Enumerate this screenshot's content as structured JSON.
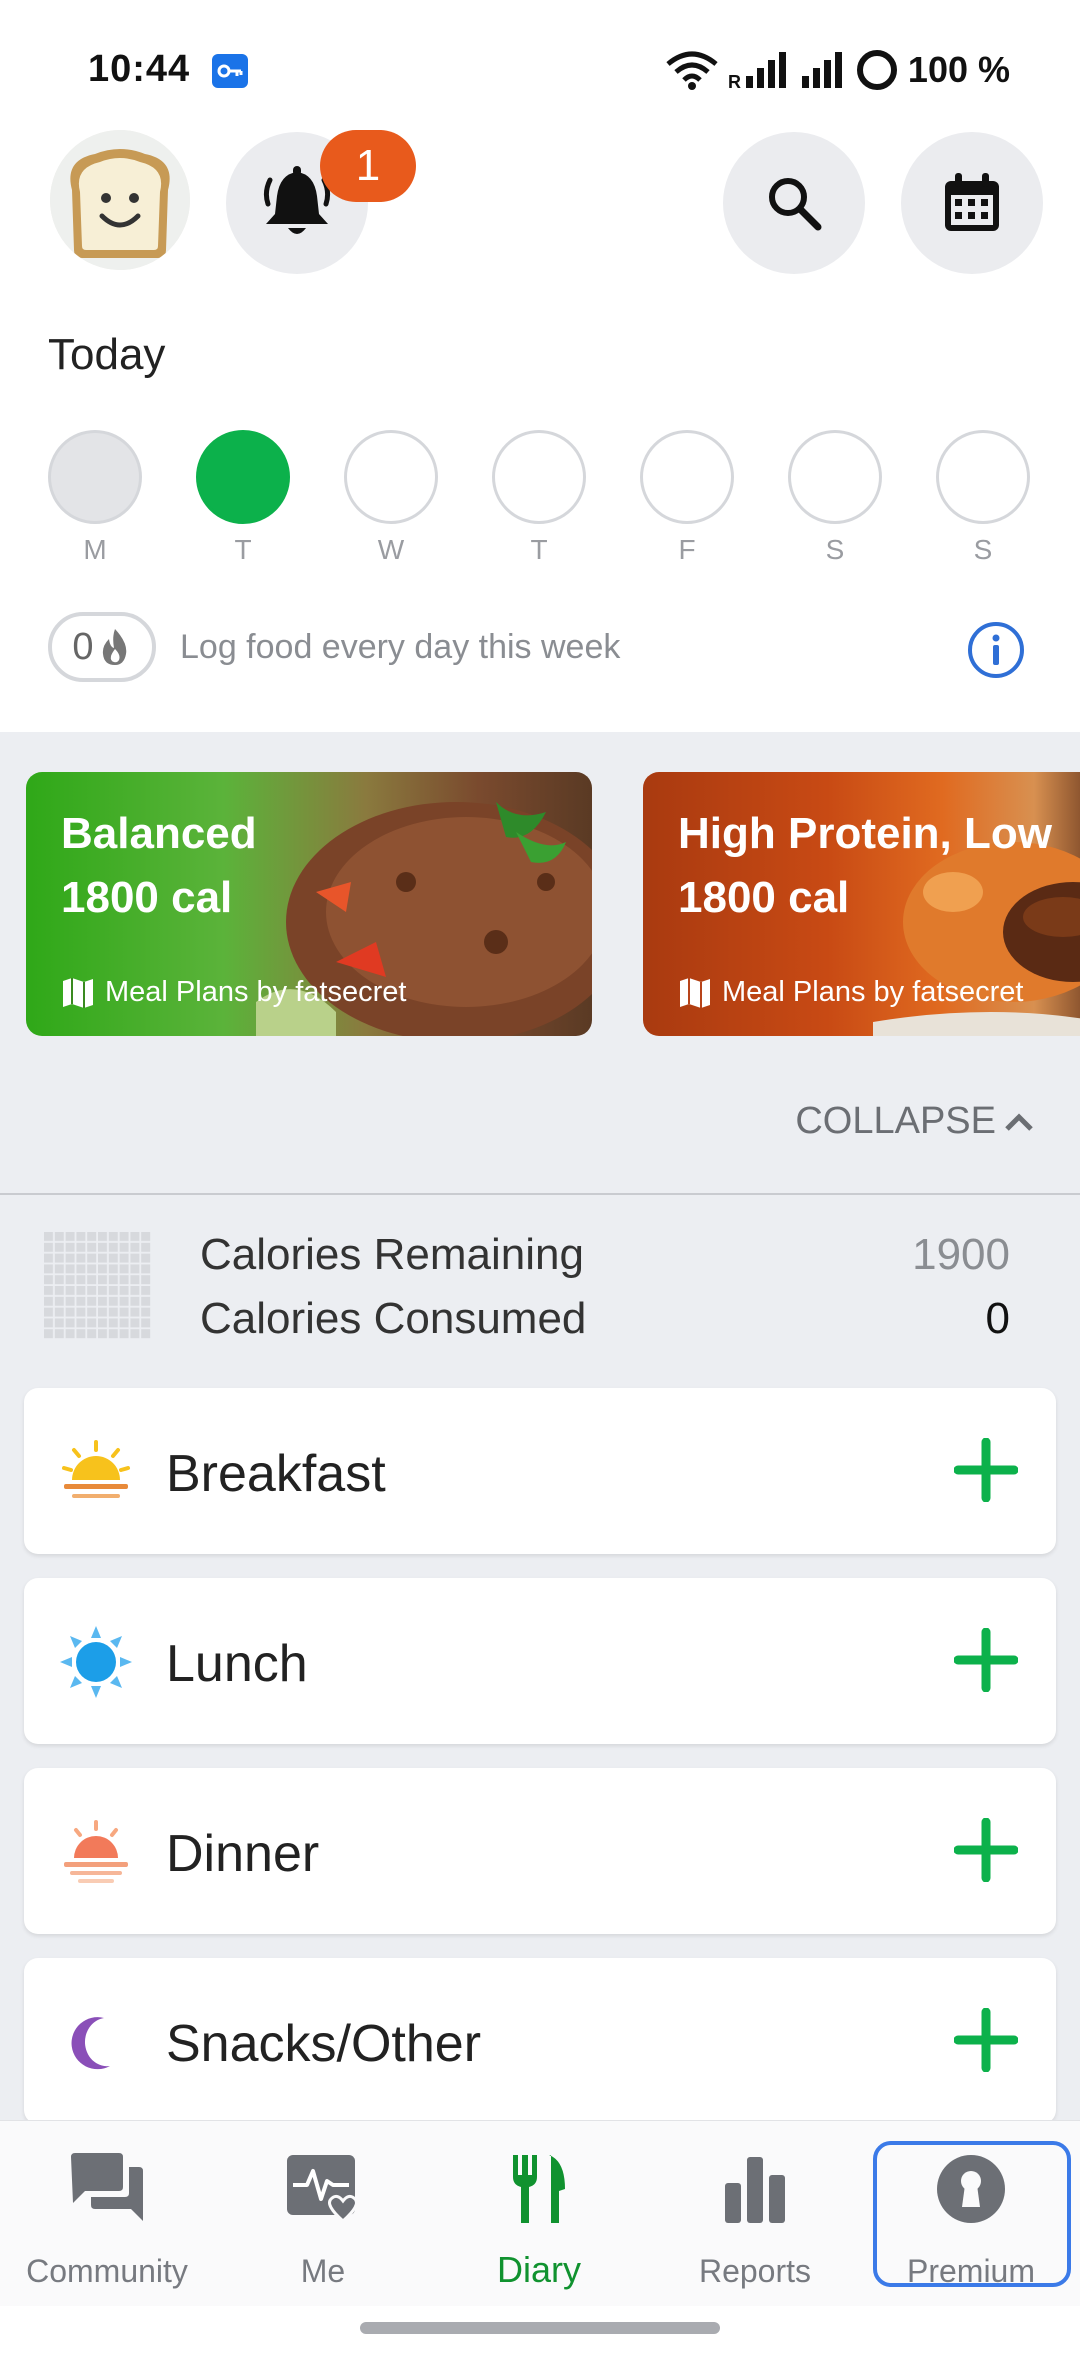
{
  "status_bar": {
    "time": "10:44",
    "battery": "100 %"
  },
  "header": {
    "notification_count": "1"
  },
  "today": {
    "label": "Today",
    "days": [
      {
        "letter": "M",
        "state": "past"
      },
      {
        "letter": "T",
        "state": "today"
      },
      {
        "letter": "W",
        "state": "future"
      },
      {
        "letter": "T",
        "state": "future"
      },
      {
        "letter": "F",
        "state": "future"
      },
      {
        "letter": "S",
        "state": "future"
      },
      {
        "letter": "S",
        "state": "future"
      }
    ],
    "streak_count": "0",
    "streak_text": "Log food every day this week"
  },
  "meal_plans": [
    {
      "title_line1": "Balanced",
      "title_line2": "1800 cal",
      "footer": "Meal Plans by fatsecret"
    },
    {
      "title_line1": "High Protein, Low",
      "title_line2": "1800 cal",
      "footer": "Meal Plans by fatsecret"
    }
  ],
  "collapse_label": "COLLAPSE",
  "calories": {
    "remaining_label": "Calories Remaining",
    "remaining_value": "1900",
    "consumed_label": "Calories Consumed",
    "consumed_value": "0"
  },
  "meals": [
    {
      "name": "Breakfast",
      "icon": "sunrise-icon"
    },
    {
      "name": "Lunch",
      "icon": "sun-icon"
    },
    {
      "name": "Dinner",
      "icon": "sunset-icon"
    },
    {
      "name": "Snacks/Other",
      "icon": "moon-icon"
    }
  ],
  "bottom_nav": {
    "community": "Community",
    "me": "Me",
    "diary": "Diary",
    "reports": "Reports",
    "premium": "Premium"
  },
  "colors": {
    "accent_green": "#0cb14b",
    "badge_orange": "#e85a1c",
    "info_blue": "#2f6fd6",
    "premium_outline": "#3b7ae8"
  }
}
